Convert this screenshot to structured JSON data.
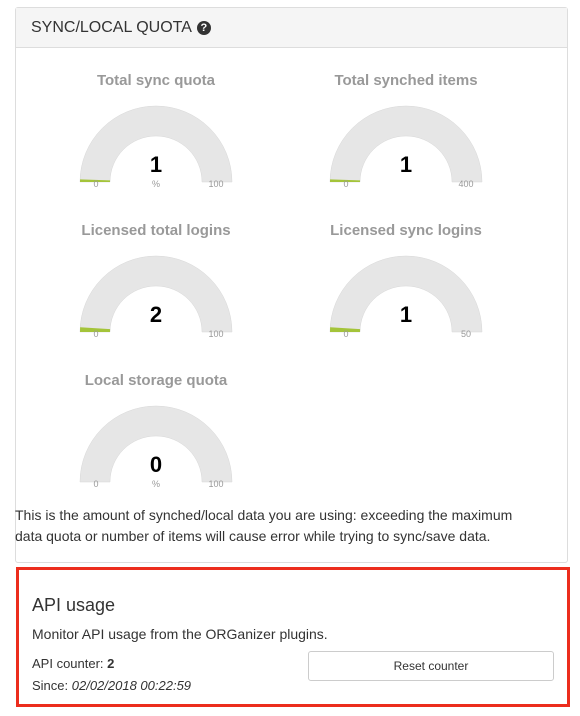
{
  "panel": {
    "title": "SYNC/LOCAL QUOTA",
    "help_icon": "question-circle-icon"
  },
  "gauges": [
    {
      "title": "Total sync quota",
      "value": "1",
      "unit": "%",
      "min": "0",
      "max": "100",
      "fill_fraction": 0.01
    },
    {
      "title": "Total synched items",
      "value": "1",
      "unit": "",
      "min": "0",
      "max": "400",
      "fill_fraction": 0.0025
    },
    {
      "title": "Licensed total logins",
      "value": "2",
      "unit": "",
      "min": "0",
      "max": "100",
      "fill_fraction": 0.02
    },
    {
      "title": "Licensed sync logins",
      "value": "1",
      "unit": "",
      "min": "0",
      "max": "50",
      "fill_fraction": 0.02
    },
    {
      "title": "Local storage quota",
      "value": "0",
      "unit": "%",
      "min": "0",
      "max": "100",
      "fill_fraction": 0.0
    }
  ],
  "note": "This is the amount of synched/local data you are using: exceeding the maximum data quota or number of items will cause error while trying to sync/save data.",
  "api": {
    "title": "API usage",
    "description": "Monitor API usage from the ORGanizer plugins.",
    "counter_label": "API counter:",
    "counter_value": "2",
    "since_label": "Since:",
    "since_value": "02/02/2018 00:22:59",
    "reset_button": "Reset counter"
  },
  "colors": {
    "gauge_track": "#e6e6e6",
    "gauge_fill": "#a4c43a",
    "highlight_border": "#ec2d1d"
  }
}
